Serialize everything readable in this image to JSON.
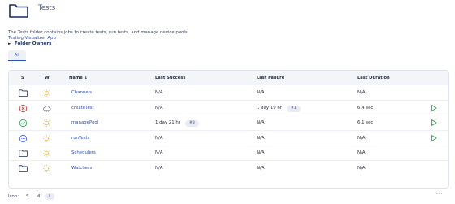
{
  "header": {
    "title": "Tests",
    "icon": "folder-icon"
  },
  "description": "The Tests folder contains jobs to create tests, run tests, and manage device pools.",
  "app_link": "Testing Visualizer App",
  "folder_owners": {
    "arrow": "►",
    "label": "Folder Owners"
  },
  "tabs": [
    {
      "label": "All",
      "active": true
    }
  ],
  "table": {
    "columns": {
      "s": "S",
      "w": "W",
      "name": "Name ↓",
      "last_success": "Last Success",
      "last_failure": "Last Failure",
      "last_duration": "Last Duration"
    },
    "rows": [
      {
        "status": "folder",
        "weather": "sunny",
        "name": "Channels",
        "last_success": "N/A",
        "last_success_badge": "",
        "last_failure": "N/A",
        "last_failure_badge": "",
        "last_duration": "N/A",
        "runnable": false
      },
      {
        "status": "failed",
        "weather": "cloudy",
        "name": "createTest",
        "last_success": "N/A",
        "last_success_badge": "",
        "last_failure": "1 day 19 hr",
        "last_failure_badge": "#1",
        "last_duration": "6.4 sec",
        "runnable": true
      },
      {
        "status": "success",
        "weather": "sunny",
        "name": "managePool",
        "last_success": "1 day 21 hr",
        "last_success_badge": "#3",
        "last_failure": "N/A",
        "last_failure_badge": "",
        "last_duration": "6.1 sec",
        "runnable": true
      },
      {
        "status": "not-built",
        "weather": "sunny",
        "name": "runTests",
        "last_success": "N/A",
        "last_success_badge": "",
        "last_failure": "N/A",
        "last_failure_badge": "",
        "last_duration": "N/A",
        "runnable": true
      },
      {
        "status": "folder",
        "weather": "sunny",
        "name": "Schedulers",
        "last_success": "N/A",
        "last_success_badge": "",
        "last_failure": "N/A",
        "last_failure_badge": "",
        "last_duration": "N/A",
        "runnable": false
      },
      {
        "status": "folder",
        "weather": "sunny",
        "name": "Watchers",
        "last_success": "N/A",
        "last_success_badge": "",
        "last_failure": "N/A",
        "last_failure_badge": "",
        "last_duration": "N/A",
        "runnable": false
      }
    ]
  },
  "footer": {
    "icon_label": "Icon:",
    "sizes": [
      "S",
      "M",
      "L"
    ],
    "active_size": "L",
    "more": "···"
  },
  "colors": {
    "accent": "#3b5bdb",
    "success": "#1e9e4a",
    "failure": "#d63031",
    "run": "#1e9e4a",
    "sun": "#f0b429"
  }
}
